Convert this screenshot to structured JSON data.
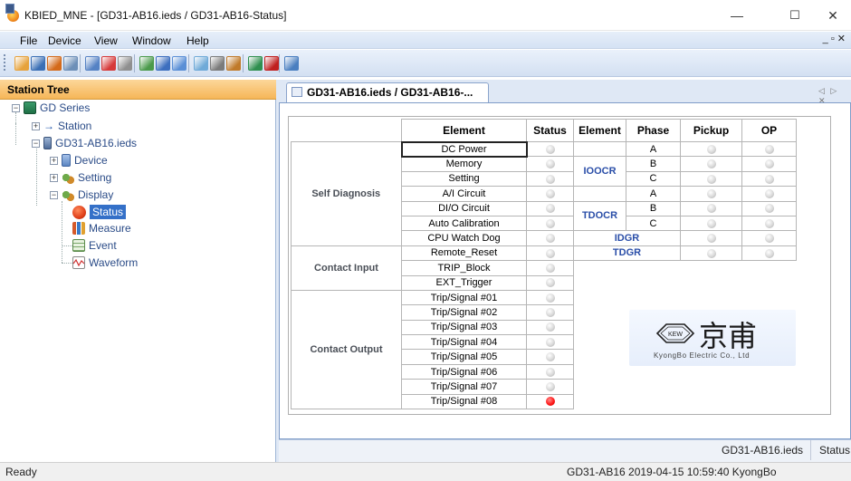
{
  "window": {
    "title": "KBIED_MNE - [GD31-AB16.ieds / GD31-AB16-Status]",
    "minimize": "—",
    "maximize": "☐",
    "close": "✕"
  },
  "menu": {
    "items": [
      "File",
      "Device",
      "View",
      "Window",
      "Help"
    ],
    "mdi_controls": "_ ▫ ✕"
  },
  "toolbar": {
    "icons": [
      "new-icon",
      "save-icon",
      "open-icon",
      "print-icon",
      "tree-icon",
      "connect-icon",
      "disconnect-icon",
      "upload-icon",
      "download-icon",
      "display-icon",
      "window-icon",
      "tile-icon",
      "cascade-icon",
      "export-icon",
      "delete-icon",
      "help-icon"
    ],
    "colors": [
      "#e6a23c",
      "#3b6fb5",
      "#d46a1a",
      "#6d8fb8",
      "#5582c4",
      "#d63a3a",
      "#8f8f8f",
      "#4b9a4b",
      "#3d6fbf",
      "#5a8fd6",
      "#6faad8",
      "#7b7b7b",
      "#c07a2a",
      "#2f8f4f",
      "#c02020",
      "#4a7fc0"
    ]
  },
  "station_tree": {
    "title": "Station Tree",
    "nodes": {
      "root": "GD Series",
      "station": "Station",
      "device_file": "GD31-AB16.ieds",
      "device": "Device",
      "setting": "Setting",
      "display": "Display",
      "status": "Status",
      "measure": "Measure",
      "event": "Event",
      "waveform": "Waveform"
    }
  },
  "tab": {
    "label": "GD31-AB16.ieds / GD31-AB16-...",
    "nav": "◁ ▷ ✕"
  },
  "status_table": {
    "headers": {
      "element": "Element",
      "status": "Status",
      "element2": "Element",
      "phase": "Phase",
      "pickup": "Pickup",
      "op": "OP"
    },
    "sections": {
      "self_diagnosis": "Self Diagnosis",
      "contact_input": "Contact Input",
      "contact_output": "Contact Output"
    },
    "elements": [
      "DC Power",
      "Memory",
      "Setting",
      "A/I Circuit",
      "DI/O Circuit",
      "Auto Calibration",
      "CPU Watch Dog",
      "Remote_Reset",
      "TRIP_Block",
      "EXT_Trigger",
      "Trip/Signal #01",
      "Trip/Signal #02",
      "Trip/Signal #03",
      "Trip/Signal #04",
      "Trip/Signal #05",
      "Trip/Signal #06",
      "Trip/Signal #07",
      "Trip/Signal #08"
    ],
    "status_on": [
      false,
      false,
      false,
      false,
      false,
      false,
      false,
      false,
      false,
      false,
      false,
      false,
      false,
      false,
      false,
      false,
      false,
      true
    ],
    "protection": {
      "ioccr": "IOOCR",
      "tdocr": "TDOCR",
      "idgr": "IDGR",
      "tdgr": "TDGR",
      "phases": [
        "A",
        "B",
        "C",
        "A",
        "B",
        "C"
      ]
    },
    "led_off_color": "#c8c8c8",
    "led_on_color": "#ff1a1a"
  },
  "logo": {
    "mark": "KEW",
    "cjk": "京甫",
    "company": "KyongBo Electric Co., Ltd"
  },
  "doc_footer": {
    "file": "GD31-AB16.ieds",
    "view": "Status"
  },
  "statusbar": {
    "left": "Ready",
    "right": "GD31-AB16  2019-04-15 10:59:40  KyongBo"
  }
}
